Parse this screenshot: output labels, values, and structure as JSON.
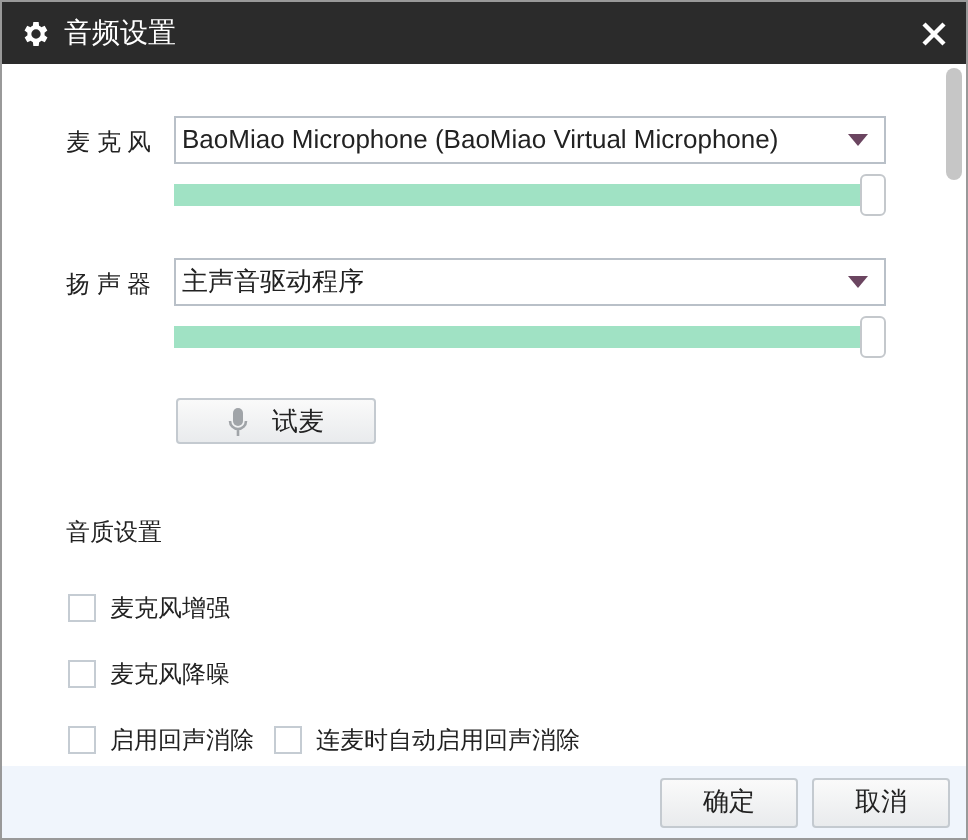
{
  "window": {
    "title": "音频设置"
  },
  "devices": [
    {
      "label": "麦 克 风",
      "value": "BaoMiao Microphone (BaoMiao Virtual Microphone)",
      "level": 1
    },
    {
      "label": "扬 声 器",
      "value": "主声音驱动程序",
      "level": 1
    }
  ],
  "test_button": "试麦",
  "quality": {
    "title": "音质设置",
    "rows": [
      [
        {
          "label": "麦克风增强",
          "checked": false
        }
      ],
      [
        {
          "label": "麦克风降噪",
          "checked": false
        }
      ],
      [
        {
          "label": "启用回声消除",
          "checked": false
        },
        {
          "label": "连麦时自动启用回声消除",
          "checked": false
        }
      ]
    ]
  },
  "buttons": [
    "确定",
    "取消"
  ]
}
